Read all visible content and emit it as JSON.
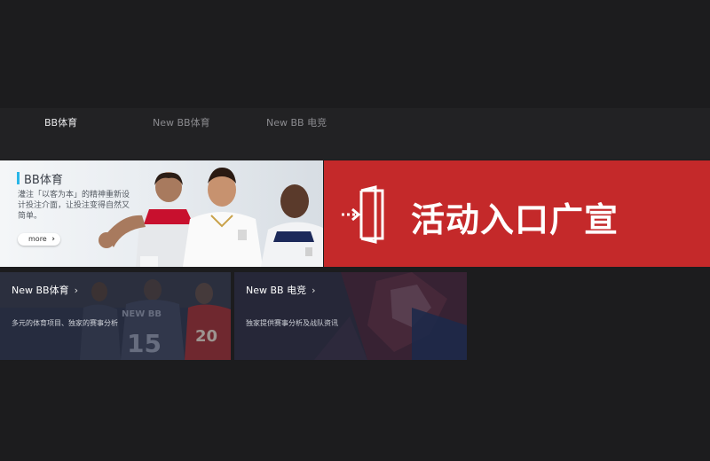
{
  "tabs": [
    {
      "label": "BB体育",
      "active": true
    },
    {
      "label": "New BB体育",
      "active": false
    },
    {
      "label": "New BB 电竞",
      "active": false
    }
  ],
  "sports_banner": {
    "title": "BB体育",
    "description": "灌注「以客为本」的精神重新设计投注介面，让投注变得自然又简单。",
    "more_label": "more",
    "accent_color": "#29b6e8"
  },
  "promo_banner": {
    "text": "活动入口广宣",
    "background_color": "#c4292a",
    "icon": "enter-door-icon"
  },
  "cards": [
    {
      "title": "New BB体育",
      "description": "多元的体育项目、独家的赛事分析",
      "jersey_text": "NEW BB"
    },
    {
      "title": "New BB 电竞",
      "description": "独家提供赛事分析及战队资讯"
    }
  ]
}
